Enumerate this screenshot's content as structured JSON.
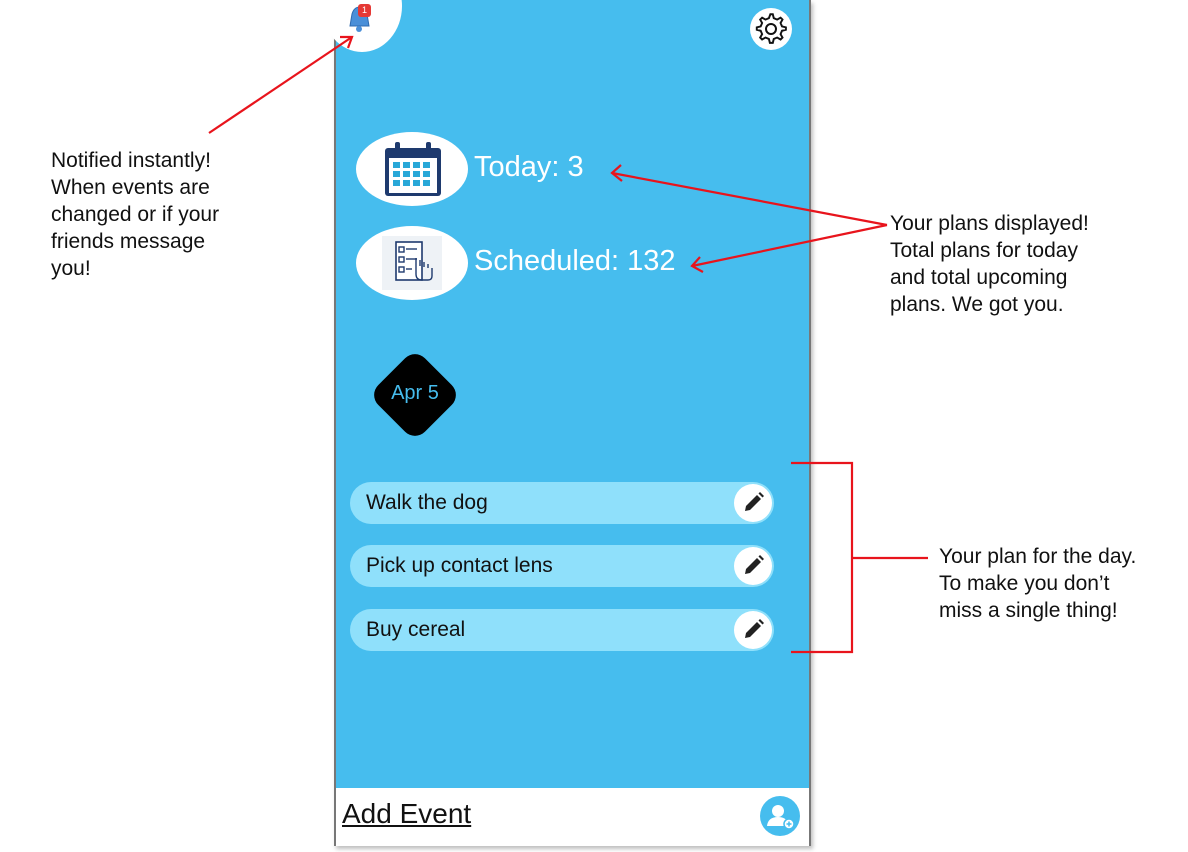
{
  "annotations": {
    "notify_lines": [
      "Notified instantly!",
      "When events are",
      "changed or if your",
      "friends message",
      "you!"
    ],
    "plans_lines": [
      "Your plans displayed!",
      "Total plans for today",
      "and total upcoming",
      "plans. We got you."
    ],
    "day_lines": [
      "Your plan for the day.",
      "To make you don’t",
      "miss a single thing!"
    ],
    "arrow_color": "#e8141c"
  },
  "header": {
    "notification_count": "1",
    "bell_icon": "bell-icon",
    "settings_icon": "gear-icon"
  },
  "stats": {
    "today_label": "Today: 3",
    "scheduled_label": "Scheduled: 132",
    "today_icon": "calendar-icon",
    "scheduled_icon": "checklist-icon"
  },
  "date_badge": "Apr 5",
  "tasks": [
    {
      "label": "Walk the dog"
    },
    {
      "label": "Pick up contact lens"
    },
    {
      "label": "Buy cereal"
    }
  ],
  "bottom": {
    "add_event_label": "Add Event",
    "profile_icon": "add-user-icon"
  },
  "colors": {
    "background": "#46bdee",
    "task_fill": "#8fe0fb",
    "badge": "#e53935"
  }
}
